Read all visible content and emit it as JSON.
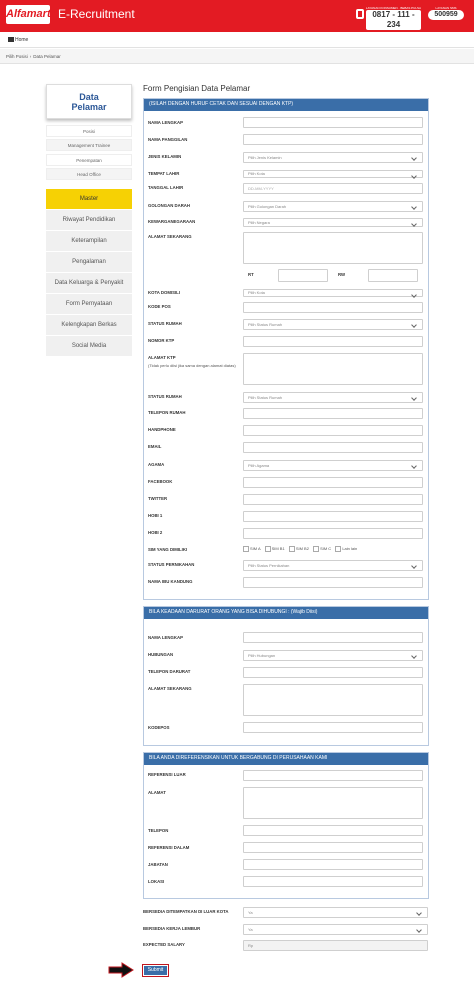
{
  "header": {
    "logo": "Alfamart",
    "title": "E-Recruitment",
    "phone_caption": "LAYANAN KONSUMEN · BEBAS PULSA",
    "phone": "0817 - 111 - 234",
    "sms_caption": "LAYANAN SMS",
    "sms": "500959"
  },
  "nav": {
    "home": "Home"
  },
  "breadcrumb": [
    "Pilih Posisi",
    "Data Pelamar"
  ],
  "sidebar": {
    "title_line1": "Data",
    "title_line2": "Pelamar",
    "positions": [
      "Posisi",
      "Management Trainee",
      "Penempatan",
      "Head Office"
    ],
    "menu": [
      "Master",
      "Riwayat Pendidikan",
      "Keterampilan",
      "Pengalaman",
      "Data Keluarga & Penyakit",
      "Form Pernyataan",
      "Kelengkapan Berkas",
      "Social Media"
    ],
    "active": "Master"
  },
  "form": {
    "title": "Form Pengisian Data Pelamar",
    "section1": {
      "title": "(ISILAH DENGAN HURUF CETAK DAN SESUAI DENGAN KTP)",
      "nama_lengkap": "NAMA LENGKAP",
      "nama_panggilan": "NAMA PANGGILAN",
      "jenis_kelamin": "JENIS KELAMIN",
      "jenis_kelamin_value": "Pilih Jenis Kelamin",
      "tempat_lahir": "TEMPAT LAHIR",
      "tempat_lahir_value": "Pilih Kota",
      "tanggal_lahir": "TANGGAL LAHIR",
      "tanggal_lahir_placeholder": "DD-MM-YYYY",
      "golongan_darah": "GOLONGAN DARAH",
      "golongan_darah_value": "Pilih Golongan Darah",
      "kewarganegaraan": "KEWARGANEGARAAN",
      "kewarganegaraan_value": "Pilih Negara",
      "alamat_sekarang": "ALAMAT SEKARANG",
      "rt": "RT",
      "rw": "RW",
      "kota_domisili": "KOTA DOMISILI",
      "kota_domisili_value": "Pilih Kota",
      "kode_pos": "KODE POS",
      "status_rumah": "STATUS RUMAH",
      "status_rumah_value": "Pilih Status Rumah",
      "nomor_ktp": "NOMOR KTP",
      "alamat_ktp": "ALAMAT KTP",
      "alamat_ktp_note": "(Tidak perlu diisi jika sama dengan alamat diatas)",
      "status_rumah2": "STATUS RUMAH",
      "status_rumah2_value": "Pilih Status Rumah",
      "telepon_rumah": "TELEPON RUMAH",
      "handphone": "HANDPHONE",
      "email": "EMAIL",
      "agama": "AGAMA",
      "agama_value": "Pilih Agama",
      "facebook": "FACEBOOK",
      "twitter": "TWITTER",
      "hobi1": "HOBI 1",
      "hobi2": "HOBI 2",
      "sim": "SIM YANG DIMILIKI",
      "sim_options": [
        "SIM A",
        "SIM B1",
        "SIM B2",
        "SIM C",
        "Lain lain"
      ],
      "status_pernikahan": "STATUS PERNIKAHAN",
      "status_pernikahan_value": "Pilih Status Pernikahan",
      "nama_ibu": "NAMA IBU KANDUNG"
    },
    "section2": {
      "title": "BILA KEADAAN DARURAT ORANG YANG BISA DIHUBUNGI : (Wajib Diisi)",
      "nama_lengkap": "NAMA LENGKAP",
      "hubungan": "HUBUNGAN",
      "hubungan_value": "Pilih Hubungan",
      "telepon_darurat": "TELEPON DARURAT",
      "alamat_sekarang": "ALAMAT SEKARANG",
      "kodepos": "KODEPOS"
    },
    "section3": {
      "title": "BILA ANDA DIREFERENSIKAN UNTUK BERGABUNG DI PERUSAHAAN KAMI",
      "referensi_luar": "REFERENSI LUAR",
      "alamat": "ALAMAT",
      "telepon": "TELEPON",
      "referensi_dalam": "REFERENSI DALAM",
      "jabatan": "JABATAN",
      "lokasi": "LOKASI"
    },
    "bersedia_luar_kota": "BERSEDIA DITEMPATKAN DI LUAR KOTA",
    "bersedia_luar_kota_value": "Ya",
    "bersedia_lembur": "BERSEDIA KERJA LEMBUR",
    "bersedia_lembur_value": "Ya",
    "expected_salary": "EXPECTED SALARY",
    "expected_salary_value": "Rp",
    "submit": "Submit"
  },
  "colors": {
    "brand_red": "#e31b23",
    "panel_blue": "#3a6ea8",
    "active_yellow": "#f6d104"
  }
}
